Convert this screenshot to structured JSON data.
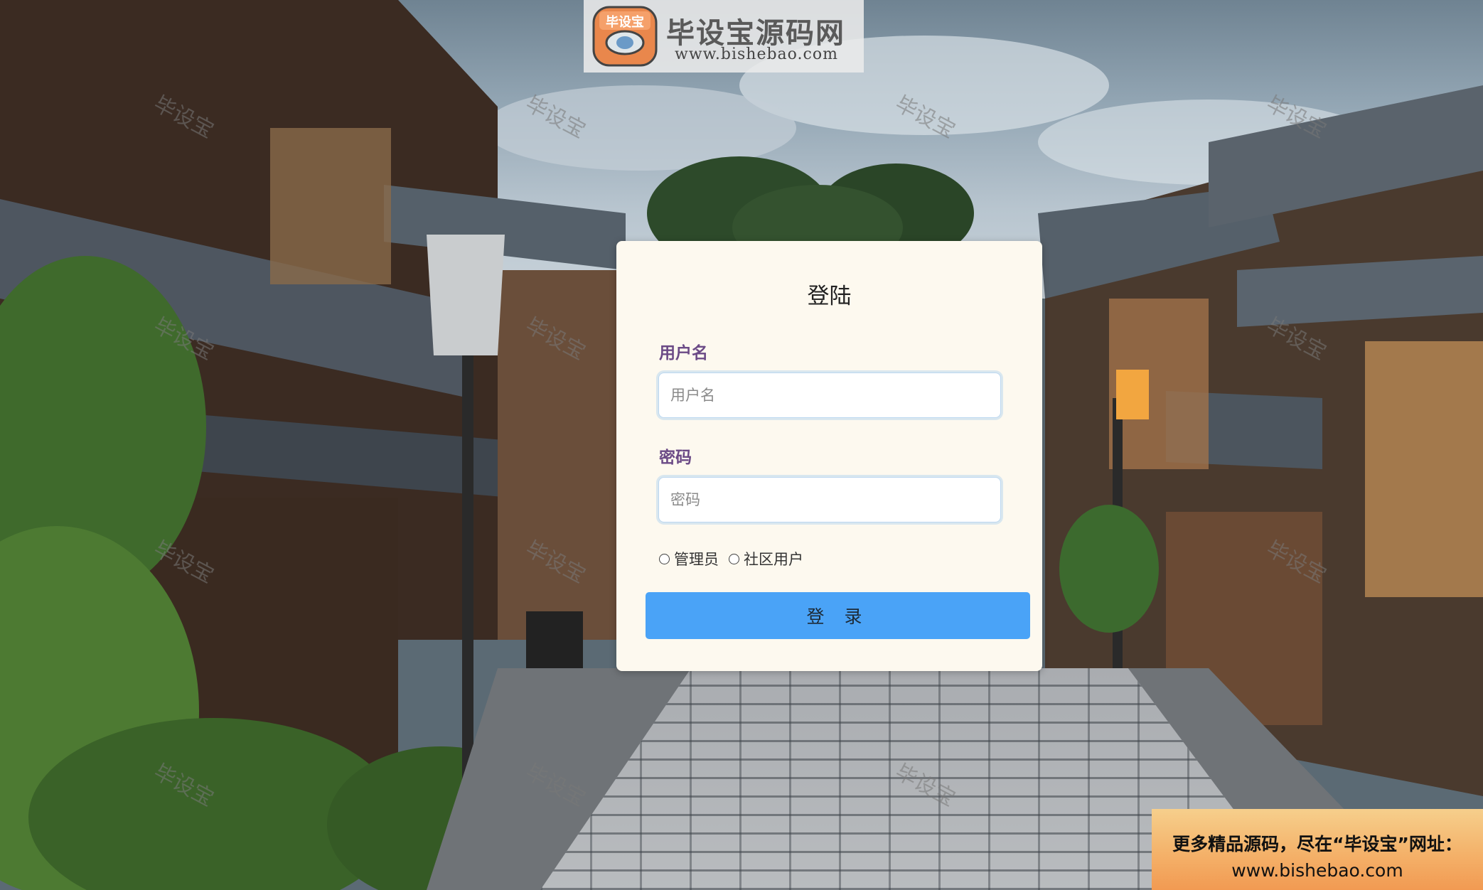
{
  "brand": {
    "badge_text": "毕设宝",
    "name": "毕设宝源码网",
    "url": "www.bishebao.com"
  },
  "watermark": "毕设宝",
  "login": {
    "title": "登陆",
    "username_label": "用户名",
    "username_placeholder": "用户名",
    "password_label": "密码",
    "password_placeholder": "密码",
    "roles": [
      {
        "label": "管理员",
        "selected": false
      },
      {
        "label": "社区用户",
        "selected": false
      }
    ],
    "submit_label": "登 录"
  },
  "promo": {
    "line1": "更多精品源码，尽在“毕设宝”网址：",
    "line2": "www.bishebao.com"
  },
  "colors": {
    "card_bg": "#fdf9ef",
    "label": "#6b4a86",
    "button": "#4aa3f7",
    "promo": "#f4b26a"
  }
}
